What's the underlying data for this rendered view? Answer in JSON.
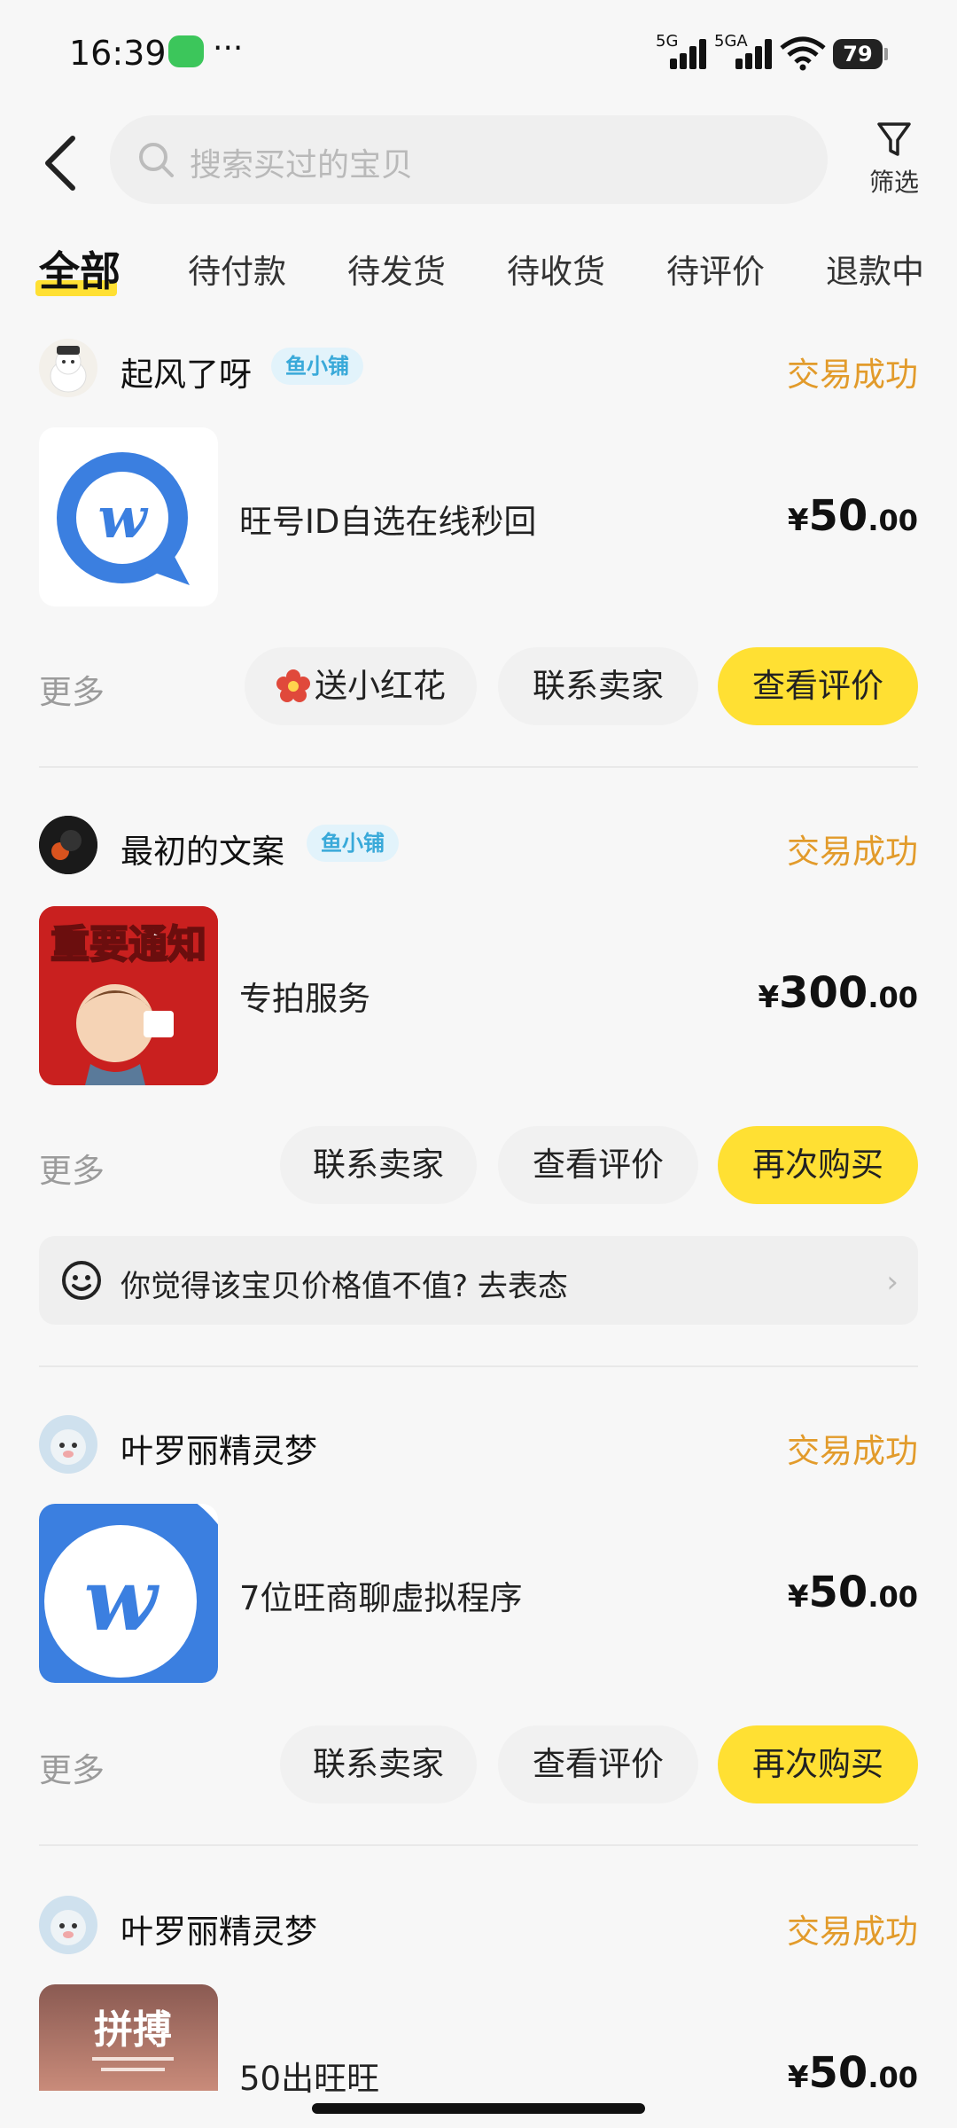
{
  "status": {
    "time": "16:39",
    "net1": "5G",
    "net2": "5GA",
    "battery": "79"
  },
  "search": {
    "placeholder": "搜索买过的宝贝",
    "filter_label": "筛选"
  },
  "tabs": [
    "全部",
    "待付款",
    "待发货",
    "待收货",
    "待评价",
    "退款中"
  ],
  "orders": [
    {
      "shop": "起风了呀",
      "tag": "鱼小铺",
      "state": "交易成功",
      "title": "旺号ID自选在线秒回",
      "price": {
        "currency": "¥",
        "int": "50",
        "dec": ".00"
      },
      "more": "更多",
      "buttons": [
        "送小红花",
        "联系卖家",
        "查看评价"
      ]
    },
    {
      "shop": "最初的文案",
      "tag": "鱼小铺",
      "state": "交易成功",
      "title": "专拍服务",
      "image_text": "重要通知",
      "price": {
        "currency": "¥",
        "int": "300",
        "dec": ".00"
      },
      "more": "更多",
      "buttons": [
        "联系卖家",
        "查看评价",
        "再次购买"
      ],
      "feedback": "你觉得该宝贝价格值不值? 去表态"
    },
    {
      "shop": "叶罗丽精灵梦",
      "state": "交易成功",
      "title": "7位旺商聊虚拟程序",
      "price": {
        "currency": "¥",
        "int": "50",
        "dec": ".00"
      },
      "more": "更多",
      "buttons": [
        "联系卖家",
        "查看评价",
        "再次购买"
      ]
    },
    {
      "shop": "叶罗丽精灵梦",
      "state": "交易成功",
      "title": "50出旺旺",
      "image_text": "拼搏",
      "price": {
        "currency": "¥",
        "int": "50",
        "dec": ".00"
      }
    }
  ]
}
